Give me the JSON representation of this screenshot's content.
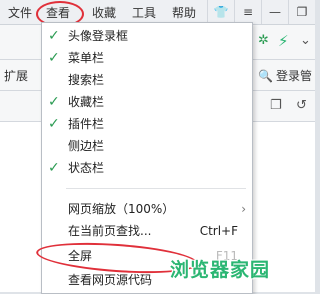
{
  "menubar": {
    "items": [
      "文件",
      "查看",
      "收藏",
      "工具",
      "帮助"
    ]
  },
  "favbar": {
    "left_label": "扩展",
    "login_label": "登录管"
  },
  "view_menu": {
    "items": [
      {
        "label": "头像登录框",
        "checked": true
      },
      {
        "label": "菜单栏",
        "checked": true
      },
      {
        "label": "搜索栏",
        "checked": false
      },
      {
        "label": "收藏栏",
        "checked": true
      },
      {
        "label": "插件栏",
        "checked": true
      },
      {
        "label": "侧边栏",
        "checked": false
      },
      {
        "label": "状态栏",
        "checked": true
      }
    ],
    "zoom_label": "网页缩放（100%）",
    "find_label": "在当前页查找...",
    "find_shortcut": "Ctrl+F",
    "fullscreen_label": "全屏",
    "fullscreen_shortcut": "F11",
    "source_label": "查看网页源代码"
  },
  "watermark": "浏览器家园",
  "accent_colors": {
    "check": "#2a9b52",
    "highlight_circle": "#e0303a",
    "watermark": "#2bb673"
  }
}
